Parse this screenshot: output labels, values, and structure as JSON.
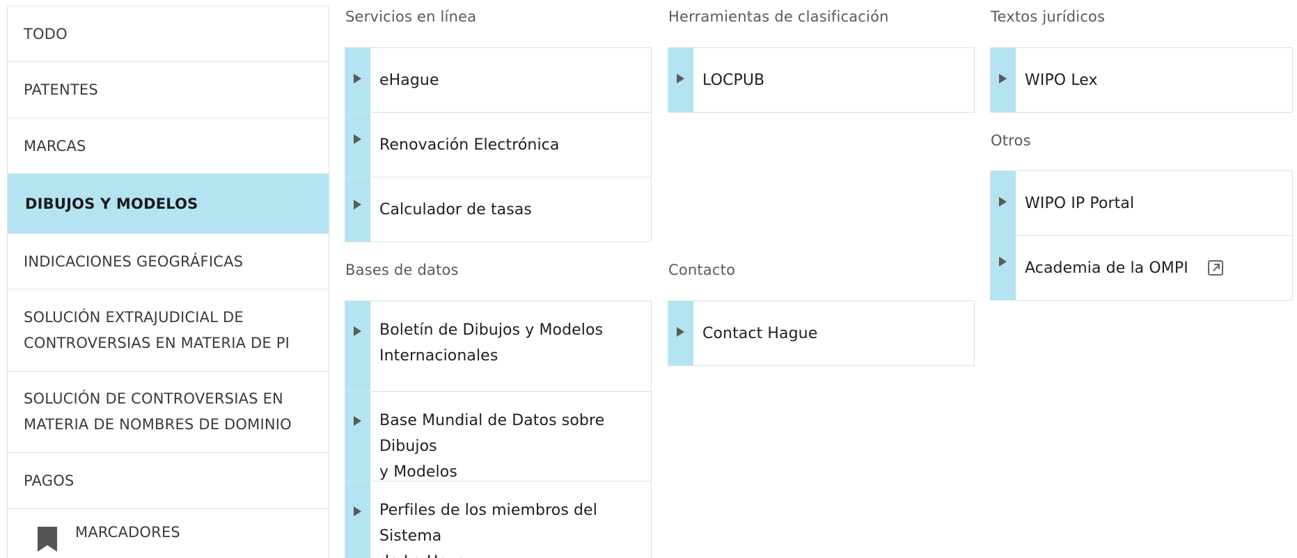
{
  "sidebar": {
    "items": [
      {
        "label": "TODO"
      },
      {
        "label": "PATENTES"
      },
      {
        "label": "MARCAS"
      },
      {
        "label": "DIBUJOS Y MODELOS",
        "active": true
      },
      {
        "label": "INDICACIONES GEOGRÁFICAS"
      },
      {
        "line1": "SOLUCIÓN EXTRAJUDICIAL DE",
        "line2": "CONTROVERSIAS EN MATERIA DE PI"
      },
      {
        "line1": "SOLUCIÓN DE CONTROVERSIAS EN",
        "line2": "MATERIA DE NOMBRES DE DOMINIO"
      },
      {
        "label": "PAGOS"
      },
      {
        "label": "MARCADORES",
        "icon": "bookmark-icon"
      }
    ]
  },
  "columns": {
    "servicios": {
      "title": "Servicios en línea",
      "items": [
        "eHague",
        "Renovación Electrónica",
        "Calculador de tasas"
      ]
    },
    "bases": {
      "title": "Bases de datos",
      "items": [
        {
          "line1": "Boletín de Dibujos y Modelos",
          "line2": "Internacionales"
        },
        {
          "line1": "Base Mundial de Datos sobre Dibujos",
          "line2": "y Modelos"
        },
        {
          "line1": "Perfiles de los miembros del Sistema",
          "line2": "de La Haya"
        }
      ]
    },
    "herramientas": {
      "title": "Herramientas de clasificación",
      "items": [
        "LOCPUB"
      ]
    },
    "contacto": {
      "title": "Contacto",
      "items": [
        "Contact Hague"
      ]
    },
    "textos": {
      "title": "Textos jurídicos",
      "items": [
        "WIPO Lex"
      ]
    },
    "otros": {
      "title": "Otros",
      "items": [
        "WIPO IP Portal",
        "Academia de la OMPI"
      ],
      "external_icon": "external-link-icon"
    }
  },
  "colors": {
    "accent": "#b4e3f1",
    "border": "#cfe6ee",
    "arrow": "#5a5a5a"
  }
}
